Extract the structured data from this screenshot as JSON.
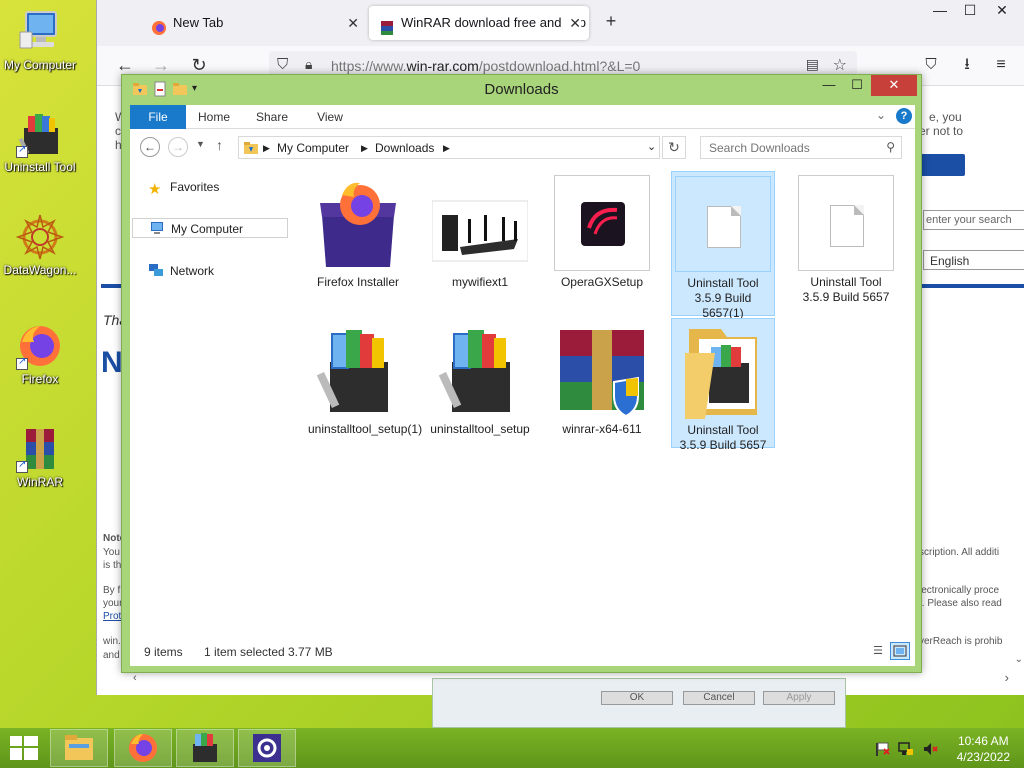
{
  "desktop": {
    "icons": [
      {
        "label": "My Computer"
      },
      {
        "label": "Uninstall Tool"
      },
      {
        "label": "DataWagon..."
      },
      {
        "label": "Firefox"
      },
      {
        "label": "WinRAR"
      }
    ]
  },
  "browser": {
    "tabs": [
      {
        "label": "New Tab",
        "icon": "firefox-icon"
      },
      {
        "label": "WinRAR download free and sup",
        "icon": "winrar-icon"
      }
    ],
    "new_tab_symbol": "+",
    "url_prefix": "https://www.",
    "url_domain": "win-rar.com",
    "url_path": "/postdownload.html?&L=0",
    "page": {
      "frag_right1": "e, you",
      "frag_right2": "er not to",
      "search_placeholder": "enter your search",
      "language": "English",
      "frag_tha": "Tha",
      "frag_n": "N",
      "note_left1": "Note",
      "note_left2": "You",
      "note_left3": "is th",
      "note_left4": "By f",
      "note_left5": "your",
      "note_left6": "Prote",
      "note_left7": "win.",
      "note_left8": "and",
      "note_right1": "scription. All additi",
      "note_right2": "lectronically proce",
      "note_right3": "r. Please also read",
      "note_right4": "verReach is prohib",
      "frag_left_w": "W",
      "frag_left_c": "c",
      "frag_left_h": "h"
    }
  },
  "dialog_behind": {
    "ok": "OK",
    "cancel": "Cancel",
    "apply": "Apply"
  },
  "explorer": {
    "title": "Downloads",
    "ribbon_tabs": [
      "File",
      "Home",
      "Share",
      "View"
    ],
    "breadcrumb": [
      "My Computer",
      "Downloads"
    ],
    "search_placeholder": "Search Downloads",
    "nav": {
      "favorites": "Favorites",
      "my_computer": "My Computer",
      "network": "Network"
    },
    "files": [
      {
        "name": "Firefox Installer",
        "selected": false
      },
      {
        "name": "mywifiext1",
        "selected": false
      },
      {
        "name": "OperaGXSetup",
        "selected": false
      },
      {
        "name": "Uninstall Tool 3.5.9 Build 5657(1)",
        "selected": true
      },
      {
        "name": "Uninstall Tool 3.5.9 Build 5657",
        "selected": false
      },
      {
        "name": "uninstalltool_setup(1)",
        "selected": false
      },
      {
        "name": "uninstalltool_setup",
        "selected": false
      },
      {
        "name": "winrar-x64-611",
        "selected": false
      },
      {
        "name": "Uninstall Tool 3.5.9 Build 5657",
        "selected": true
      }
    ],
    "status": {
      "count": "9 items",
      "selection": "1 item selected",
      "size": "3.77 MB"
    }
  },
  "taskbar": {
    "time": "10:46 AM",
    "date": "4/23/2022"
  }
}
